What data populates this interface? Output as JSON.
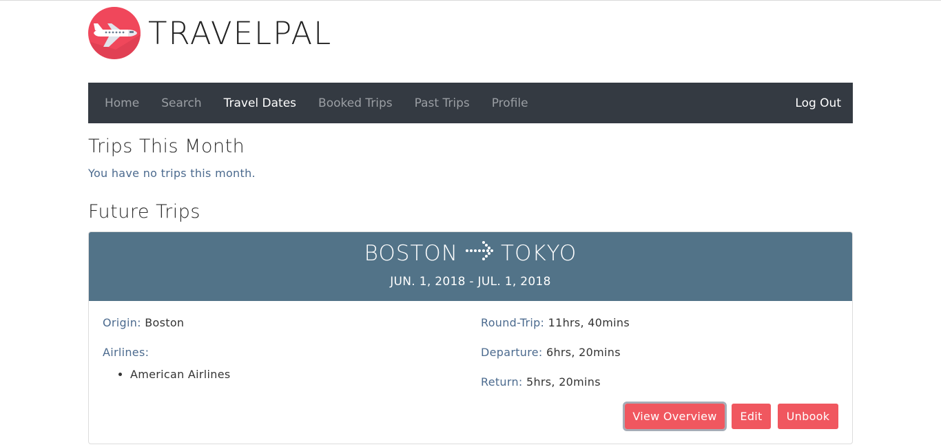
{
  "brand": {
    "name": "TRAVELPAL"
  },
  "nav": {
    "items": [
      {
        "label": "Home",
        "active": false
      },
      {
        "label": "Search",
        "active": false
      },
      {
        "label": "Travel Dates",
        "active": true
      },
      {
        "label": "Booked Trips",
        "active": false
      },
      {
        "label": "Past Trips",
        "active": false
      },
      {
        "label": "Profile",
        "active": false
      }
    ],
    "logout": "Log Out"
  },
  "this_month": {
    "title": "Trips This Month",
    "empty_text": "You have no trips this month."
  },
  "future": {
    "title": "Future Trips",
    "trip": {
      "origin_city": "BOSTON",
      "destination_city": "TOKYO",
      "dates": "JUN. 1, 2018 - JUL. 1, 2018",
      "origin_label": "Origin:",
      "origin_value": "Boston",
      "airlines_label": "Airlines:",
      "airlines": [
        "American Airlines"
      ],
      "round_trip_label": "Round-Trip:",
      "round_trip_value": "11hrs, 40mins",
      "departure_label": "Departure:",
      "departure_value": "6hrs, 20mins",
      "return_label": "Return:",
      "return_value": "5hrs, 20mins",
      "buttons": {
        "view": "View Overview",
        "edit": "Edit",
        "unbook": "Unbook"
      }
    }
  },
  "colors": {
    "logo": "#f0475b",
    "navbar": "#343a42",
    "card_header": "#527388",
    "button": "#f0575f",
    "label": "#4b6a8e"
  }
}
